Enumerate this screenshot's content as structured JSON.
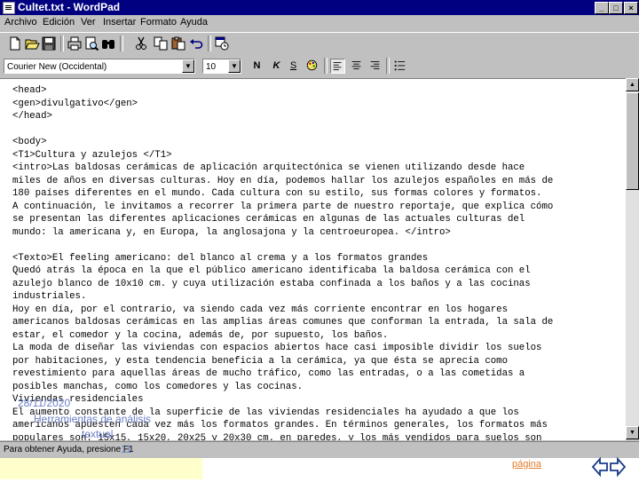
{
  "window": {
    "title": "Cultet.txt - WordPad",
    "caption_buttons": {
      "minimize": "_",
      "maximize": "□",
      "close": "×"
    }
  },
  "menu": [
    "Archivo",
    "Edición",
    "Ver",
    "Insertar",
    "Formato",
    "Ayuda"
  ],
  "toolbar": {
    "buttons": [
      "new-document-icon",
      "open-folder-icon",
      "save-disk-icon",
      "print-icon",
      "print-preview-icon",
      "find-binoculars-icon",
      "cut-scissors-icon",
      "copy-icon",
      "paste-icon",
      "undo-icon",
      "date-time-icon"
    ]
  },
  "format_bar": {
    "font": "Courier New (Occidental)",
    "size": "10",
    "bold": "N",
    "italic": "K",
    "underline": "S"
  },
  "document": {
    "lines": [
      "<head>",
      "<gen>divulgativo</gen>",
      "</head>",
      "",
      "<body>",
      "<T1>Cultura y azulejos </T1>",
      "<intro>Las baldosas cerámicas de aplicación arquitectónica se vienen utilizando desde hace",
      "miles de años en diversas culturas. Hoy en día, podemos hallar los azulejos españoles en más de",
      "180 países diferentes en el mundo. Cada cultura con su estilo, sus formas colores y formatos.",
      "A continuación, le invitamos a recorrer la primera parte de nuestro reportaje, que explica cómo",
      "se presentan las diferentes aplicaciones cerámicas en algunas de las actuales culturas del",
      "mundo: la americana y, en Europa, la anglosajona y la centroeuropea. </intro>",
      "",
      "<Texto>El feeling americano: del blanco al crema y a los formatos grandes",
      "Quedó atrás la época en la que el público americano identificaba la baldosa cerámica con el",
      "azulejo blanco de 10x10 cm. y cuya utilización estaba confinada a los baños y a las cocinas",
      "industriales.",
      "Hoy en día, por el contrario, va siendo cada vez más corriente encontrar en los hogares",
      "americanos baldosas cerámicas en las amplias áreas comunes que conforman la entrada, la sala de",
      "estar, el comedor y la cocina, además de, por supuesto, los baños.",
      "La moda de diseñar las viviendas con espacios abiertos hace casi imposible dividir los suelos",
      "por habitaciones, y esta tendencia beneficia a la cerámica, ya que ésta se aprecia como",
      "revestimiento para aquellas áreas de mucho tráfico, como las entradas, o a las cometidas a",
      "posibles manchas, como los comedores y las cocinas.",
      "Viviendas residenciales",
      "El aumento constante de la superficie de las viviendas residenciales ha ayudado a que los",
      "americanos apuesten cada vez más los formatos grandes. En términos generales, los formatos más",
      "populares son: 15x15, 15x20, 20x25 y 20x30 cm. en paredes, y los más vendidos para suelos son"
    ]
  },
  "status": {
    "text": "Para obtener Ayuda, presione F1"
  },
  "slide_overlay": {
    "date": "28/11/2020",
    "line1": "Herramientas de análisis",
    "line2": "textual",
    "page_number": "11",
    "page_link": "página"
  }
}
